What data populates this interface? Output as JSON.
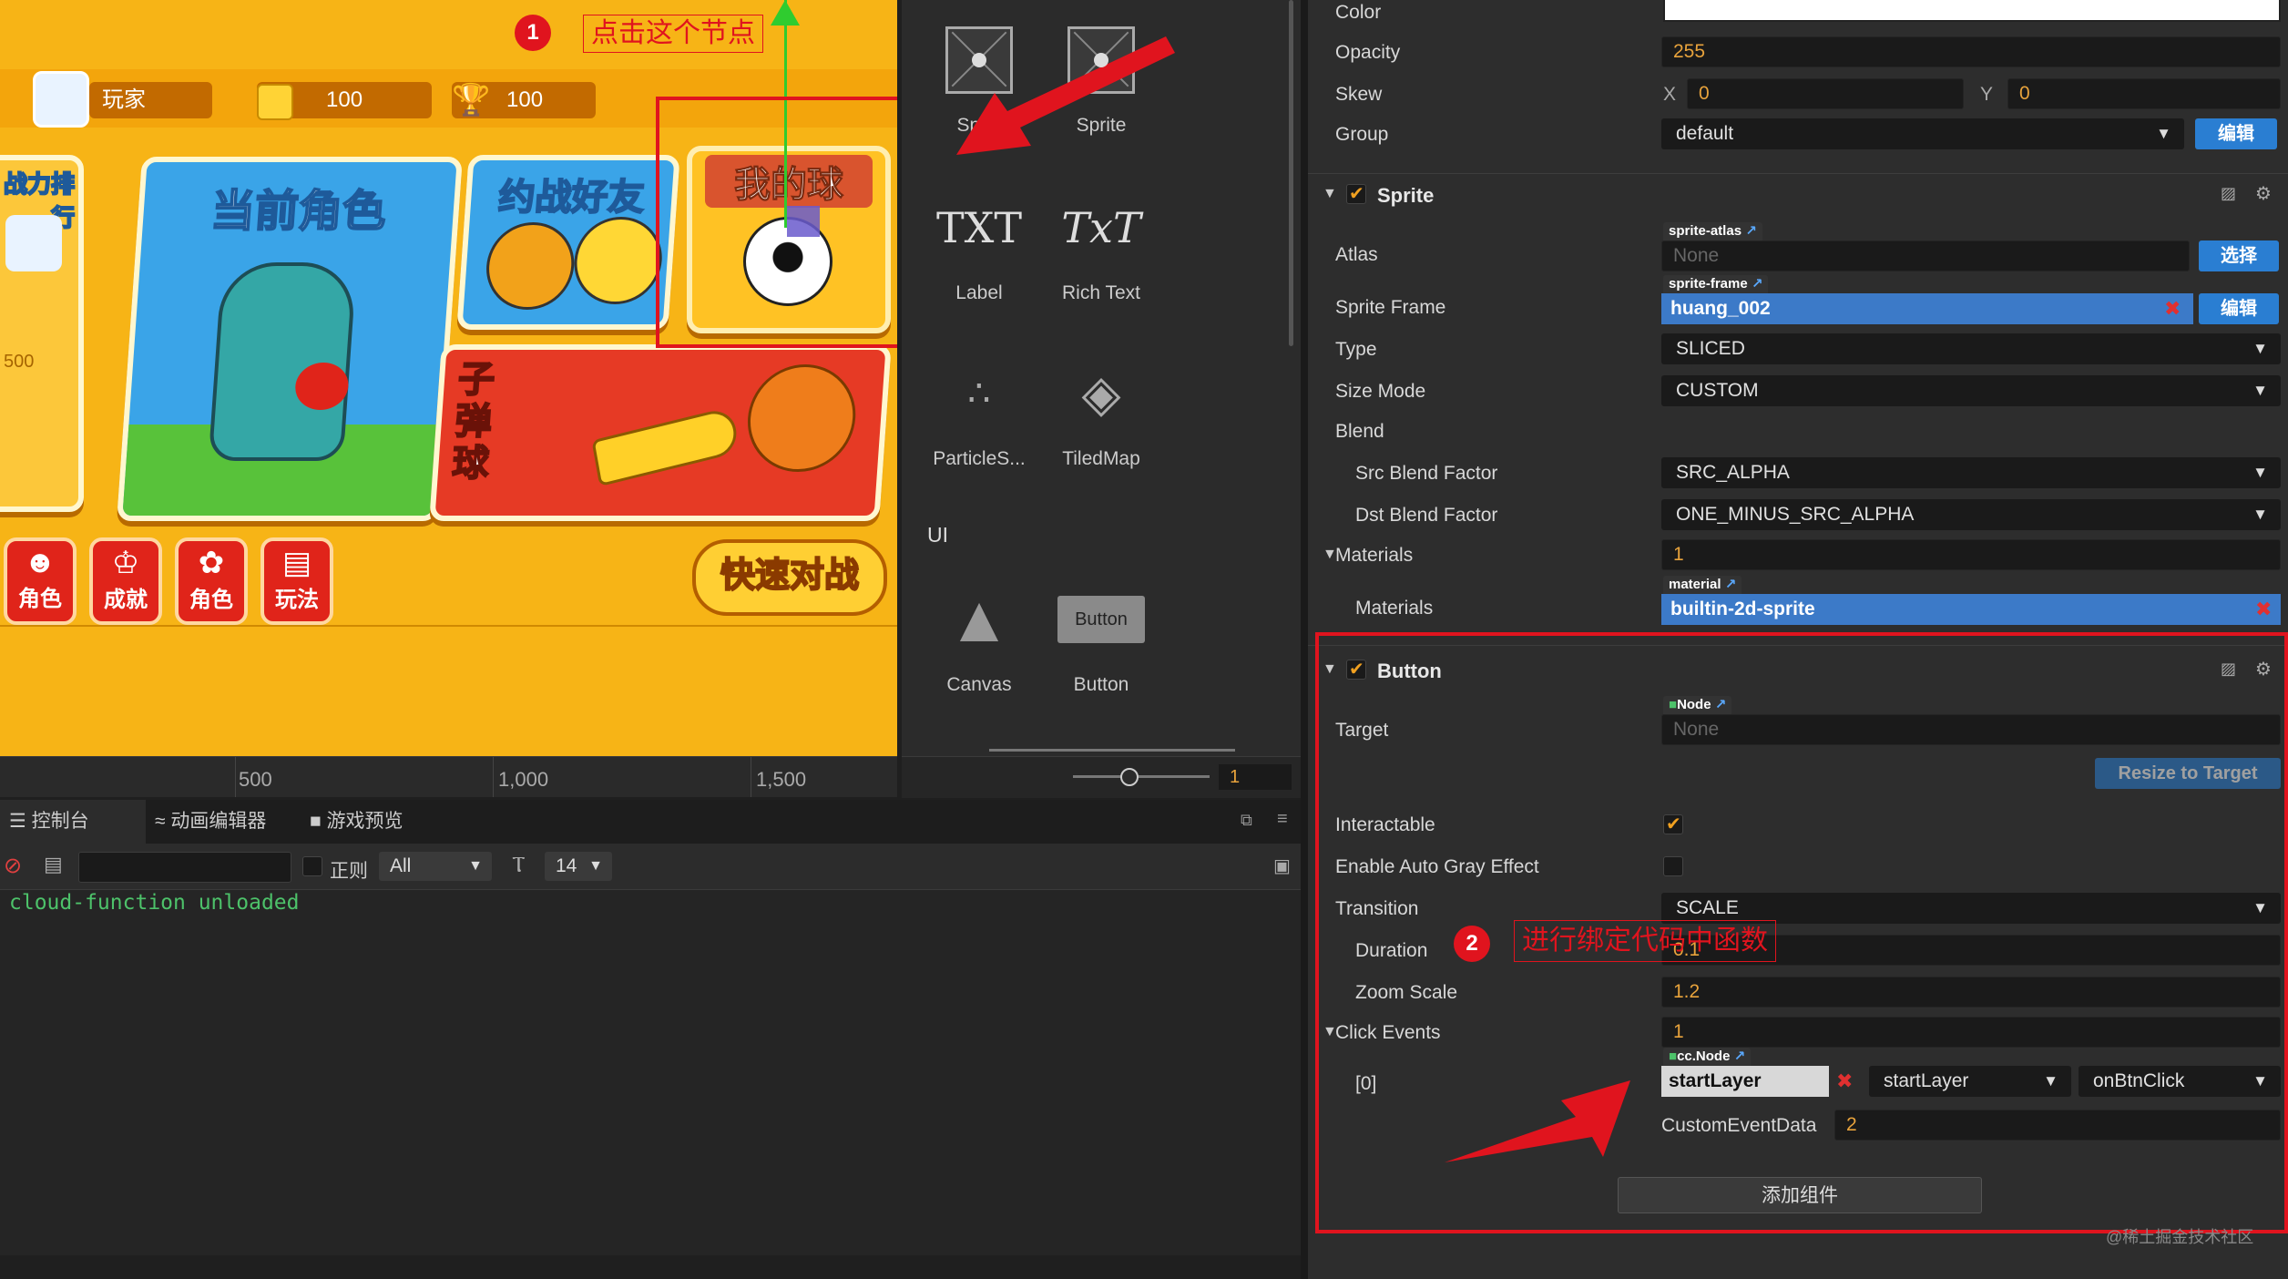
{
  "game": {
    "player_name": "玩家",
    "coins": "100",
    "trophies": "100",
    "rank_title": "战力排行",
    "rank_value": "500",
    "current_role": "当前角色",
    "battle_friend": "约战好友",
    "my_ball": "我的球",
    "bullet_ball": "子弹球",
    "quick_battle": "快速对战",
    "bottom_buttons": [
      "角色",
      "成就",
      "角色",
      "玩法"
    ]
  },
  "ruler": {
    "ticks": [
      "500",
      "1,000",
      "1,500"
    ]
  },
  "annotations": {
    "one": {
      "num": "1",
      "text": "点击这个节点"
    },
    "two": {
      "num": "2",
      "text": "进行绑定代码中函数"
    }
  },
  "assets": {
    "items": [
      {
        "label": "Spr...",
        "name": "sprite-splash"
      },
      {
        "label": "Sprite"
      },
      {
        "label": "Label",
        "glyph": "TXT"
      },
      {
        "label": "Rich Text",
        "glyph": "TxT"
      },
      {
        "label": "ParticleS..."
      },
      {
        "label": "TiledMap"
      },
      {
        "label": "Canvas"
      },
      {
        "label": "Button",
        "glyph": "Button"
      }
    ],
    "ui_header": "UI",
    "zoom_value": "1"
  },
  "console": {
    "tabs": [
      "控制台",
      "动画编辑器",
      "游戏预览"
    ],
    "regex_label": "正则",
    "filter_value": "All",
    "font_size": "14",
    "log": "cloud-function unloaded"
  },
  "inspector": {
    "color_label": "Color",
    "opacity_label": "Opacity",
    "opacity_value": "255",
    "skew_label": "Skew",
    "skew_x_label": "X",
    "skew_x": "0",
    "skew_y_label": "Y",
    "skew_y": "0",
    "group_label": "Group",
    "group_value": "default",
    "edit_btn": "编辑",
    "sprite": {
      "title": "Sprite",
      "atlas_label": "Atlas",
      "atlas_tag": "sprite-atlas",
      "atlas_value": "None",
      "select_btn": "选择",
      "frame_label": "Sprite Frame",
      "frame_tag": "sprite-frame",
      "frame_value": "huang_002",
      "type_label": "Type",
      "type_value": "SLICED",
      "size_mode_label": "Size Mode",
      "size_mode_value": "CUSTOM",
      "blend_label": "Blend",
      "src_label": "Src Blend Factor",
      "src_value": "SRC_ALPHA",
      "dst_label": "Dst Blend Factor",
      "dst_value": "ONE_MINUS_SRC_ALPHA",
      "materials_label": "Materials",
      "materials_count": "1",
      "material_tag": "material",
      "material_value": "builtin-2d-sprite"
    },
    "button": {
      "title": "Button",
      "target_label": "Target",
      "target_tag": "Node",
      "target_value": "None",
      "resize_btn": "Resize to Target",
      "interactable_label": "Interactable",
      "auto_gray_label": "Enable Auto Gray Effect",
      "transition_label": "Transition",
      "transition_value": "SCALE",
      "duration_label": "Duration",
      "duration_value": "0.1",
      "zoom_label": "Zoom Scale",
      "zoom_value": "1.2",
      "click_events_label": "Click Events",
      "click_events_count": "1",
      "event_index": "[0]",
      "event_tag": "cc.Node",
      "event_node": "startLayer",
      "event_component": "startLayer",
      "event_handler": "onBtnClick",
      "custom_label": "CustomEventData",
      "custom_value": "2"
    },
    "add_component_btn": "添加组件",
    "watermark": "@稀土掘金技术社区"
  },
  "colors": {
    "accent": "#2a7ed2",
    "annotation_red": "#e0141e",
    "game_orange": "#f7b416"
  }
}
